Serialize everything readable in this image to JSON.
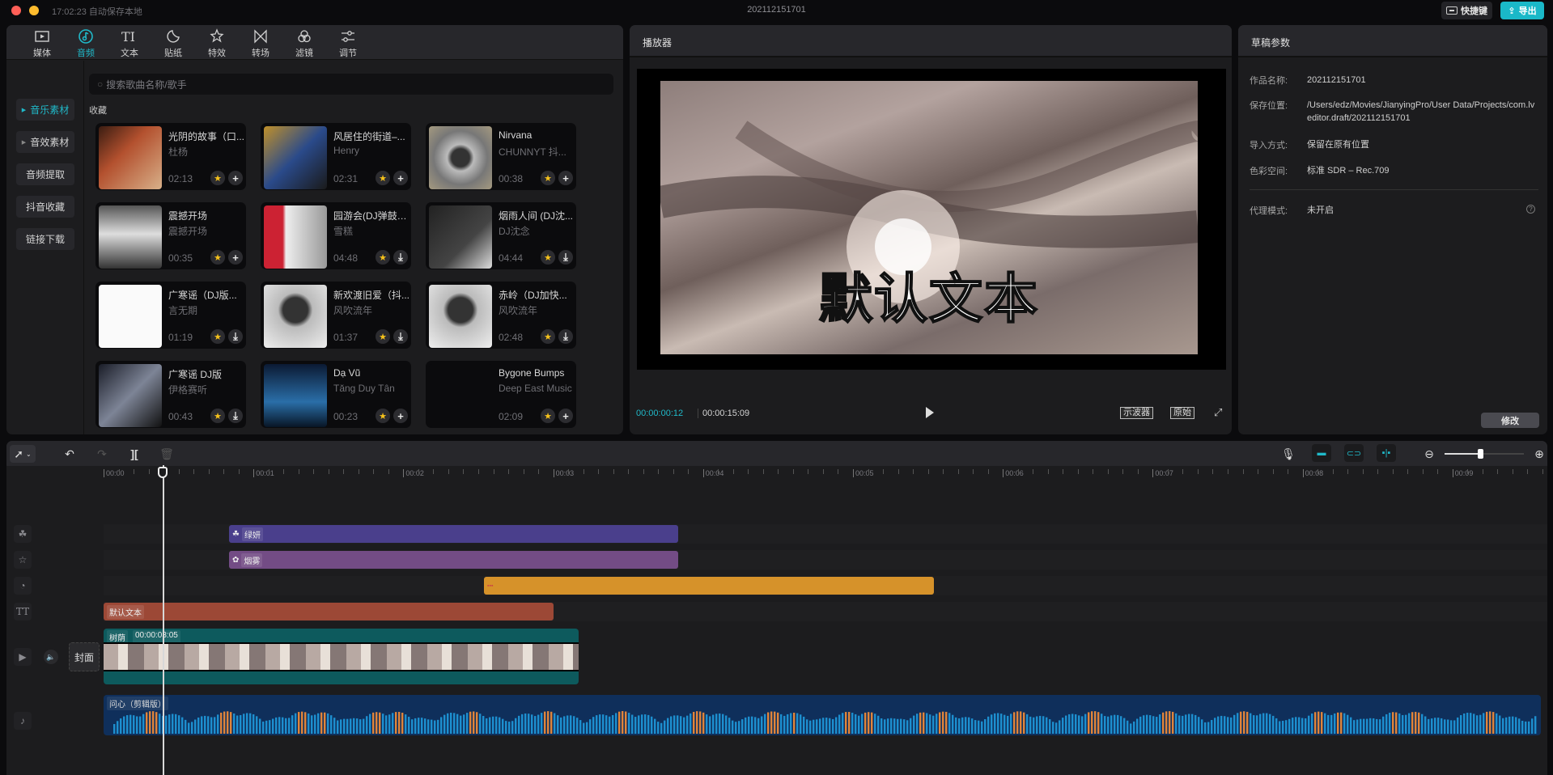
{
  "titlebar": {
    "save_status": "17:02:23 自动保存本地",
    "title": "202112151701",
    "shortcut_label": "快捷键",
    "export_label": "导出"
  },
  "library": {
    "tabs": [
      {
        "label": "媒体",
        "icon": "media-icon",
        "active": false
      },
      {
        "label": "音频",
        "icon": "audio-icon",
        "active": true
      },
      {
        "label": "文本",
        "icon": "text-icon",
        "active": false
      },
      {
        "label": "贴纸",
        "icon": "sticker-icon",
        "active": false
      },
      {
        "label": "特效",
        "icon": "effects-icon",
        "active": false
      },
      {
        "label": "转场",
        "icon": "transition-icon",
        "active": false
      },
      {
        "label": "滤镜",
        "icon": "filter-icon",
        "active": false
      },
      {
        "label": "调节",
        "icon": "adjust-icon",
        "active": false
      }
    ],
    "side_items": [
      {
        "label": "音乐素材",
        "active": true,
        "expandable": true
      },
      {
        "label": "音效素材",
        "active": false,
        "expandable": true
      },
      {
        "label": "音频提取",
        "active": false,
        "expandable": false
      },
      {
        "label": "抖音收藏",
        "active": false,
        "expandable": false
      },
      {
        "label": "链接下载",
        "active": false,
        "expandable": false
      }
    ],
    "search_placeholder": "搜索歌曲名称/歌手",
    "section_label": "收藏",
    "tracks": [
      {
        "title": "光阴的故事（口...",
        "artist": "杜杨",
        "duration": "02:13",
        "action": "add"
      },
      {
        "title": "风居住的街道–...",
        "artist": "Henry",
        "duration": "02:31",
        "action": "add"
      },
      {
        "title": "Nirvana",
        "artist": "CHUNNYT 抖...",
        "duration": "00:38",
        "action": "add"
      },
      {
        "title": "震撼开场",
        "artist": "震撼开场",
        "duration": "00:35",
        "action": "add"
      },
      {
        "title": "园游会(DJ弹鼓版)",
        "artist": "雪糕",
        "duration": "04:48",
        "action": "download"
      },
      {
        "title": "烟雨人间 (DJ沈...",
        "artist": "DJ沈念",
        "duration": "04:44",
        "action": "download"
      },
      {
        "title": "广寒谣（DJ版...",
        "artist": "言无期",
        "duration": "01:19",
        "action": "download"
      },
      {
        "title": "新欢渡旧爱（抖...",
        "artist": "风吹流年",
        "duration": "01:37",
        "action": "download"
      },
      {
        "title": "赤岭（DJ加快...",
        "artist": "风吹流年",
        "duration": "02:48",
        "action": "download"
      },
      {
        "title": "广寒谣 DJ版",
        "artist": "伊格赛听",
        "duration": "00:43",
        "action": "download"
      },
      {
        "title": "Dạ Vũ",
        "artist": "Tăng Duy Tân",
        "duration": "00:23",
        "action": "add"
      },
      {
        "title": "Bygone Bumps",
        "artist": "Deep East Music",
        "duration": "02:09",
        "action": "add"
      }
    ]
  },
  "player": {
    "title": "播放器",
    "subtitle_text": "默认文本",
    "current_time": "00:00:00:12",
    "total_time": "00:00:15:09",
    "scope_label": "示波器",
    "original_label": "原始"
  },
  "params": {
    "title": "草稿参数",
    "rows": [
      {
        "key": "作品名称:",
        "value": "202112151701"
      },
      {
        "key": "保存位置:",
        "value": "/Users/edz/Movies/JianyingPro/User Data/Projects/com.lveditor.draft/202112151701"
      },
      {
        "key": "导入方式:",
        "value": "保留在原有位置"
      },
      {
        "key": "色彩空间:",
        "value": "标准 SDR – Rec.709"
      },
      {
        "key": "代理模式:",
        "value": "未开启"
      }
    ],
    "modify_label": "修改"
  },
  "timeline": {
    "ruler_labels": [
      "00:00",
      "00:01",
      "00:02",
      "00:03",
      "00:04",
      "00:05",
      "00:06",
      "00:07",
      "00:08",
      "00:09"
    ],
    "playhead_seconds": 0.4,
    "zoom_level": 0.45,
    "cover_label": "封面",
    "clips": {
      "filter": {
        "label": "绿妍",
        "color": "#4a3f8c"
      },
      "effect": {
        "label": "烟雾",
        "color": "#734c85"
      },
      "sticker": {
        "label": "",
        "color": "#d6922a"
      },
      "text": {
        "label": "默认文本",
        "color": "#9c4836"
      },
      "video": {
        "label": "树荫",
        "duration": "00:00:03:05",
        "color": "#0d5a5d"
      },
      "audio": {
        "label": "问心（剪辑版）",
        "color": "#0f2f5b"
      }
    }
  },
  "colors": {
    "accent": "#20b9c9",
    "star": "#f6c21b"
  }
}
